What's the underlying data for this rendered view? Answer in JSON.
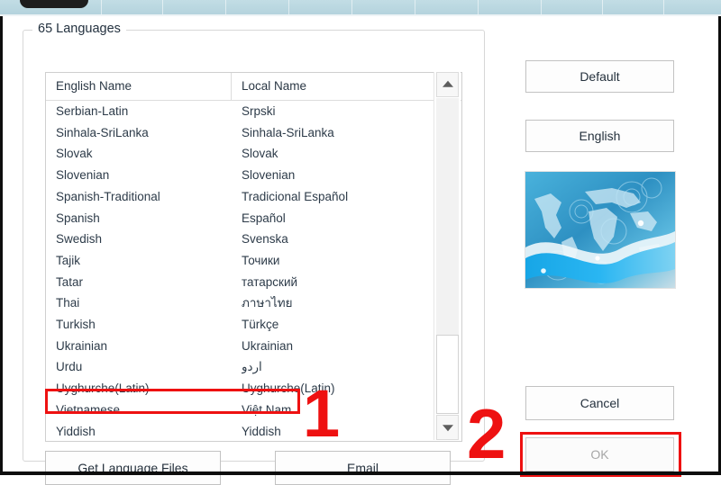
{
  "window": {
    "top_strip_color": "#b4d3dd"
  },
  "group": {
    "label": "65 Languages"
  },
  "table": {
    "columns": [
      "English Name",
      "Local Name"
    ],
    "rows": [
      {
        "english": "Serbian-Latin",
        "local": "Srpski"
      },
      {
        "english": "Sinhala-SriLanka",
        "local": "Sinhala-SriLanka"
      },
      {
        "english": "Slovak",
        "local": "Slovak"
      },
      {
        "english": "Slovenian",
        "local": "Slovenian"
      },
      {
        "english": "Spanish-Traditional",
        "local": "Tradicional Español"
      },
      {
        "english": "Spanish",
        "local": "Español"
      },
      {
        "english": "Swedish",
        "local": "Svenska"
      },
      {
        "english": "Tajik",
        "local": "Точики"
      },
      {
        "english": "Tatar",
        "local": "татарский"
      },
      {
        "english": "Thai",
        "local": "ภาษาไทย"
      },
      {
        "english": "Turkish",
        "local": "Türkçe"
      },
      {
        "english": "Ukrainian",
        "local": "Ukrainian"
      },
      {
        "english": "Urdu",
        "local": "اردو"
      },
      {
        "english": "Uyghurche(Latin)",
        "local": "Uyghurche(Latin)"
      },
      {
        "english": "Vietnamese",
        "local": "Việt Nam"
      },
      {
        "english": "Yiddish",
        "local": "Yiddish"
      }
    ]
  },
  "buttons": {
    "get_language_files": "Get Language Files",
    "email": "Email",
    "default": "Default",
    "english": "English",
    "cancel": "Cancel",
    "ok": "OK"
  },
  "annotations": {
    "step_one": "1",
    "step_two": "2",
    "color": "#ee1111"
  },
  "image": {
    "alt": "world-map-blue-wave"
  }
}
